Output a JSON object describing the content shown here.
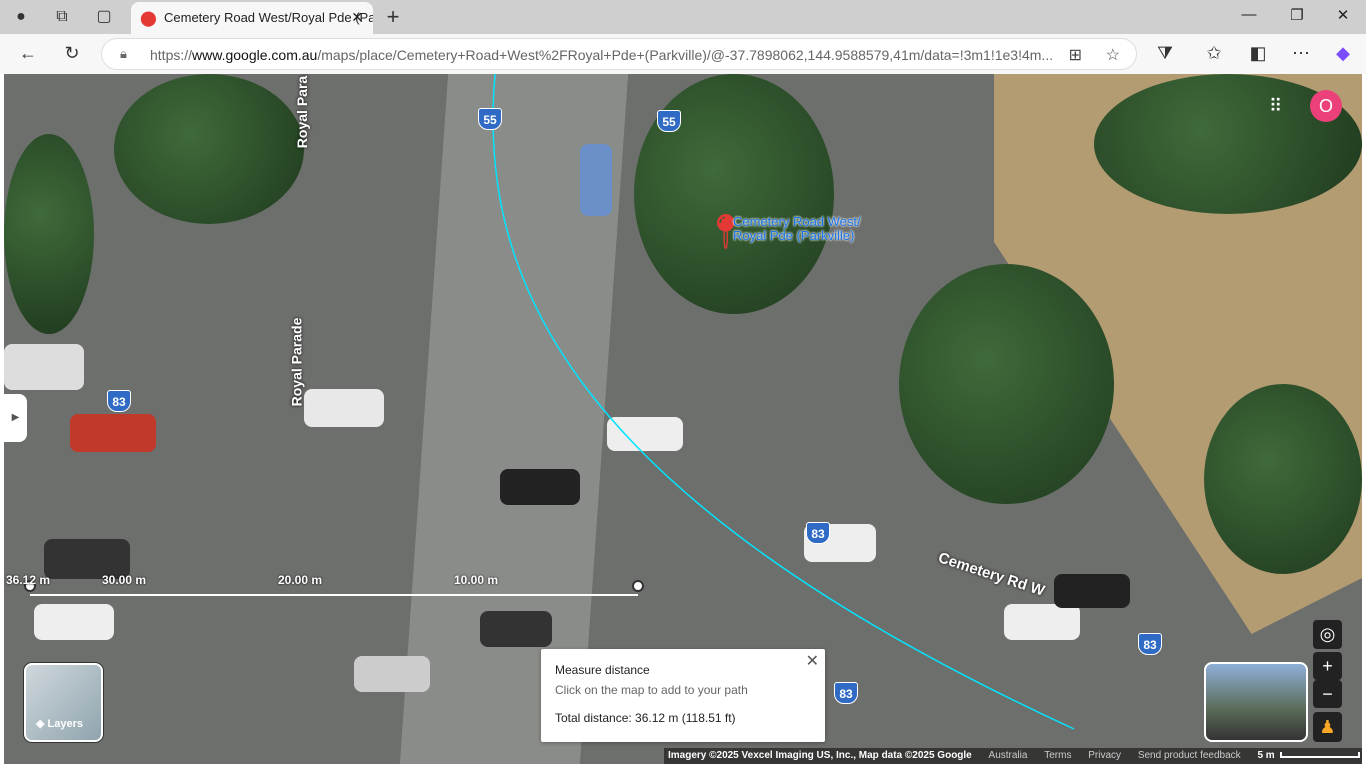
{
  "browser": {
    "tab_title": "Cemetery Road West/Royal Pde (Parkville)",
    "url_scheme": "https://",
    "url_domain": "www.google.com.au",
    "url_path": "/maps/place/Cemetery+Road+West%2FRoyal+Pde+(Parkville)/@-37.7898062,144.9588579,41m/data=!3m1!1e3!4m..."
  },
  "map": {
    "place_label": "Cemetery Road West/ Royal Pde (Parkville)",
    "road_labels": [
      "Royal Para",
      "Royal Parade",
      "Cemetery Rd W"
    ],
    "shields": [
      "55",
      "55",
      "83",
      "83",
      "83",
      "83"
    ],
    "ruler": {
      "labels": [
        "36.12 m",
        "30.00 m",
        "20.00 m",
        "10.00 m"
      ]
    },
    "measure": {
      "title": "Measure distance",
      "hint": "Click on the map to add to your path",
      "total": "Total distance: 36.12 m (118.51 ft)"
    },
    "layers_label": "Layers",
    "avatar_letter": "O",
    "footer": {
      "imagery": "Imagery ©2025 Vexcel Imaging US, Inc., Map data ©2025 Google",
      "region": "Australia",
      "terms": "Terms",
      "privacy": "Privacy",
      "feedback": "Send product feedback",
      "scale": "5 m"
    },
    "measure_line_color": "#00e5ff"
  }
}
